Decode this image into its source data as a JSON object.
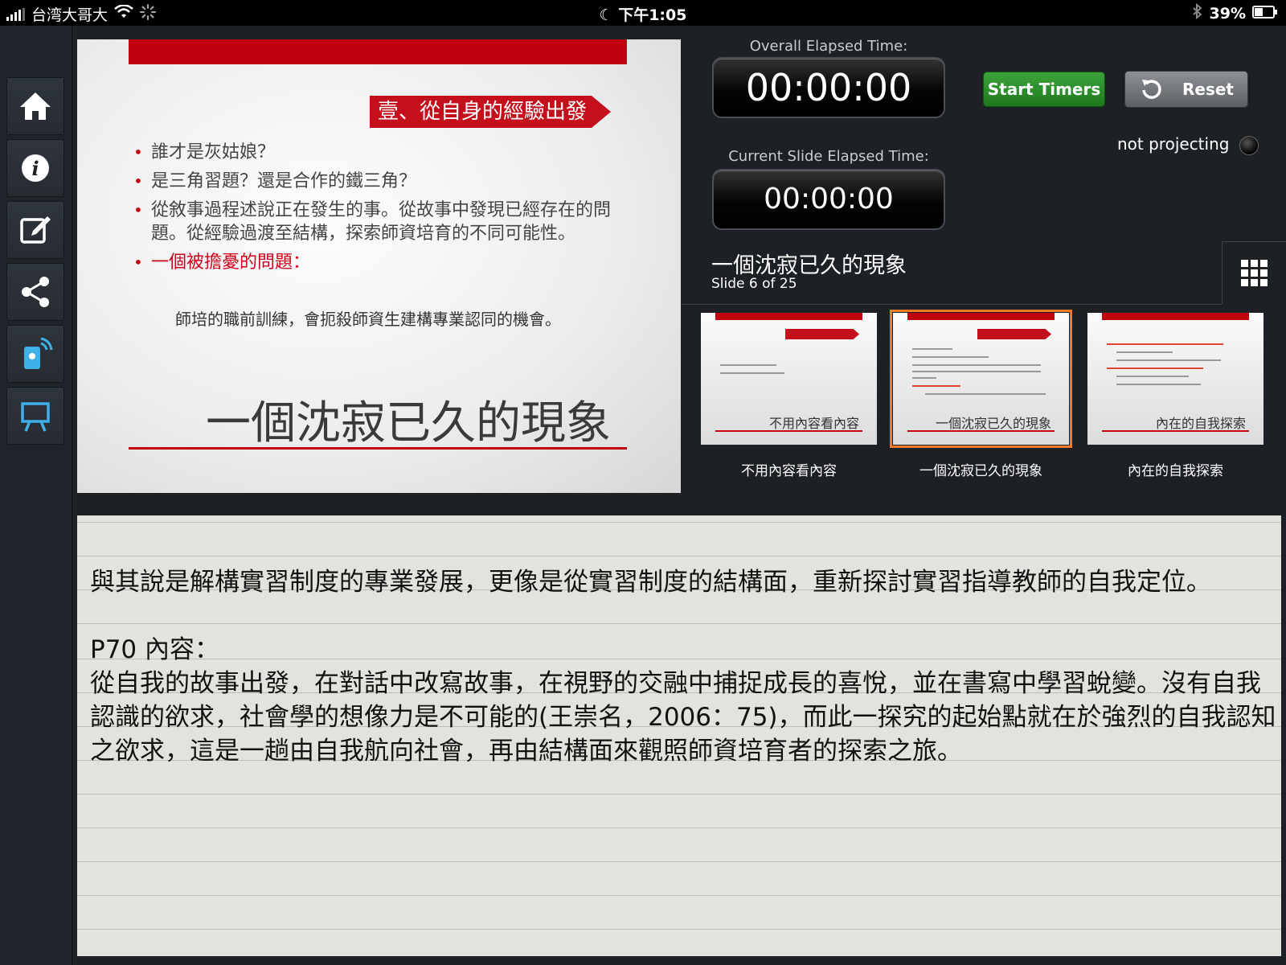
{
  "status_bar": {
    "carrier": "台湾大哥大",
    "time": "下午1:05",
    "battery": "39%"
  },
  "sidebar": {
    "items": [
      "home",
      "info",
      "edit",
      "share",
      "remote",
      "present"
    ]
  },
  "slide": {
    "tag": "壹、從自身的經驗出發",
    "bullets": [
      "誰才是灰姑娘？",
      "是三角習題？還是合作的鐵三角？",
      "從敘事過程述說正在發生的事。從故事中發現已經存在的問題。從經驗過渡至結構，探索師資培育的不同可能性。",
      "一個被擔憂的問題："
    ],
    "sub": "師培的職前訓練，會扼殺師資生建構專業認同的機會。",
    "title": "一個沈寂已久的現象"
  },
  "timers": {
    "overall_label": "Overall Elapsed Time:",
    "overall_value": "00:00:00",
    "slide_label": "Current Slide Elapsed Time:",
    "slide_value": "00:00:00",
    "start_label": "Start Timers",
    "reset_label": "Reset"
  },
  "projection": {
    "label": "not projecting"
  },
  "current": {
    "title": "一個沈寂已久的現象",
    "count": "Slide 6 of 25"
  },
  "thumbnails": [
    {
      "caption": "不用內容看內容",
      "title": "不用內容看內容"
    },
    {
      "caption": "一個沈寂已久的現象",
      "title": "一個沈寂已久的現象"
    },
    {
      "caption": "內在的自我探索",
      "title": "內在的自我探索"
    }
  ],
  "notes": {
    "text": "與其說是解構實習制度的專業發展，更像是從實習制度的結構面，重新探討實習指導教師的自我定位。\n\nP70 內容：\n從自我的故事出發，在對話中改寫故事，在視野的交融中捕捉成長的喜悅，並在書寫中學習蛻變。沒有自我認識的欲求，社會學的想像力是不可能的(王崇名，2006：75)，而此一探究的起始點就在於強烈的自我認知之欲求，這是一趟由自我航向社會，再由結構面來觀照師資培育者的探索之旅。"
  }
}
